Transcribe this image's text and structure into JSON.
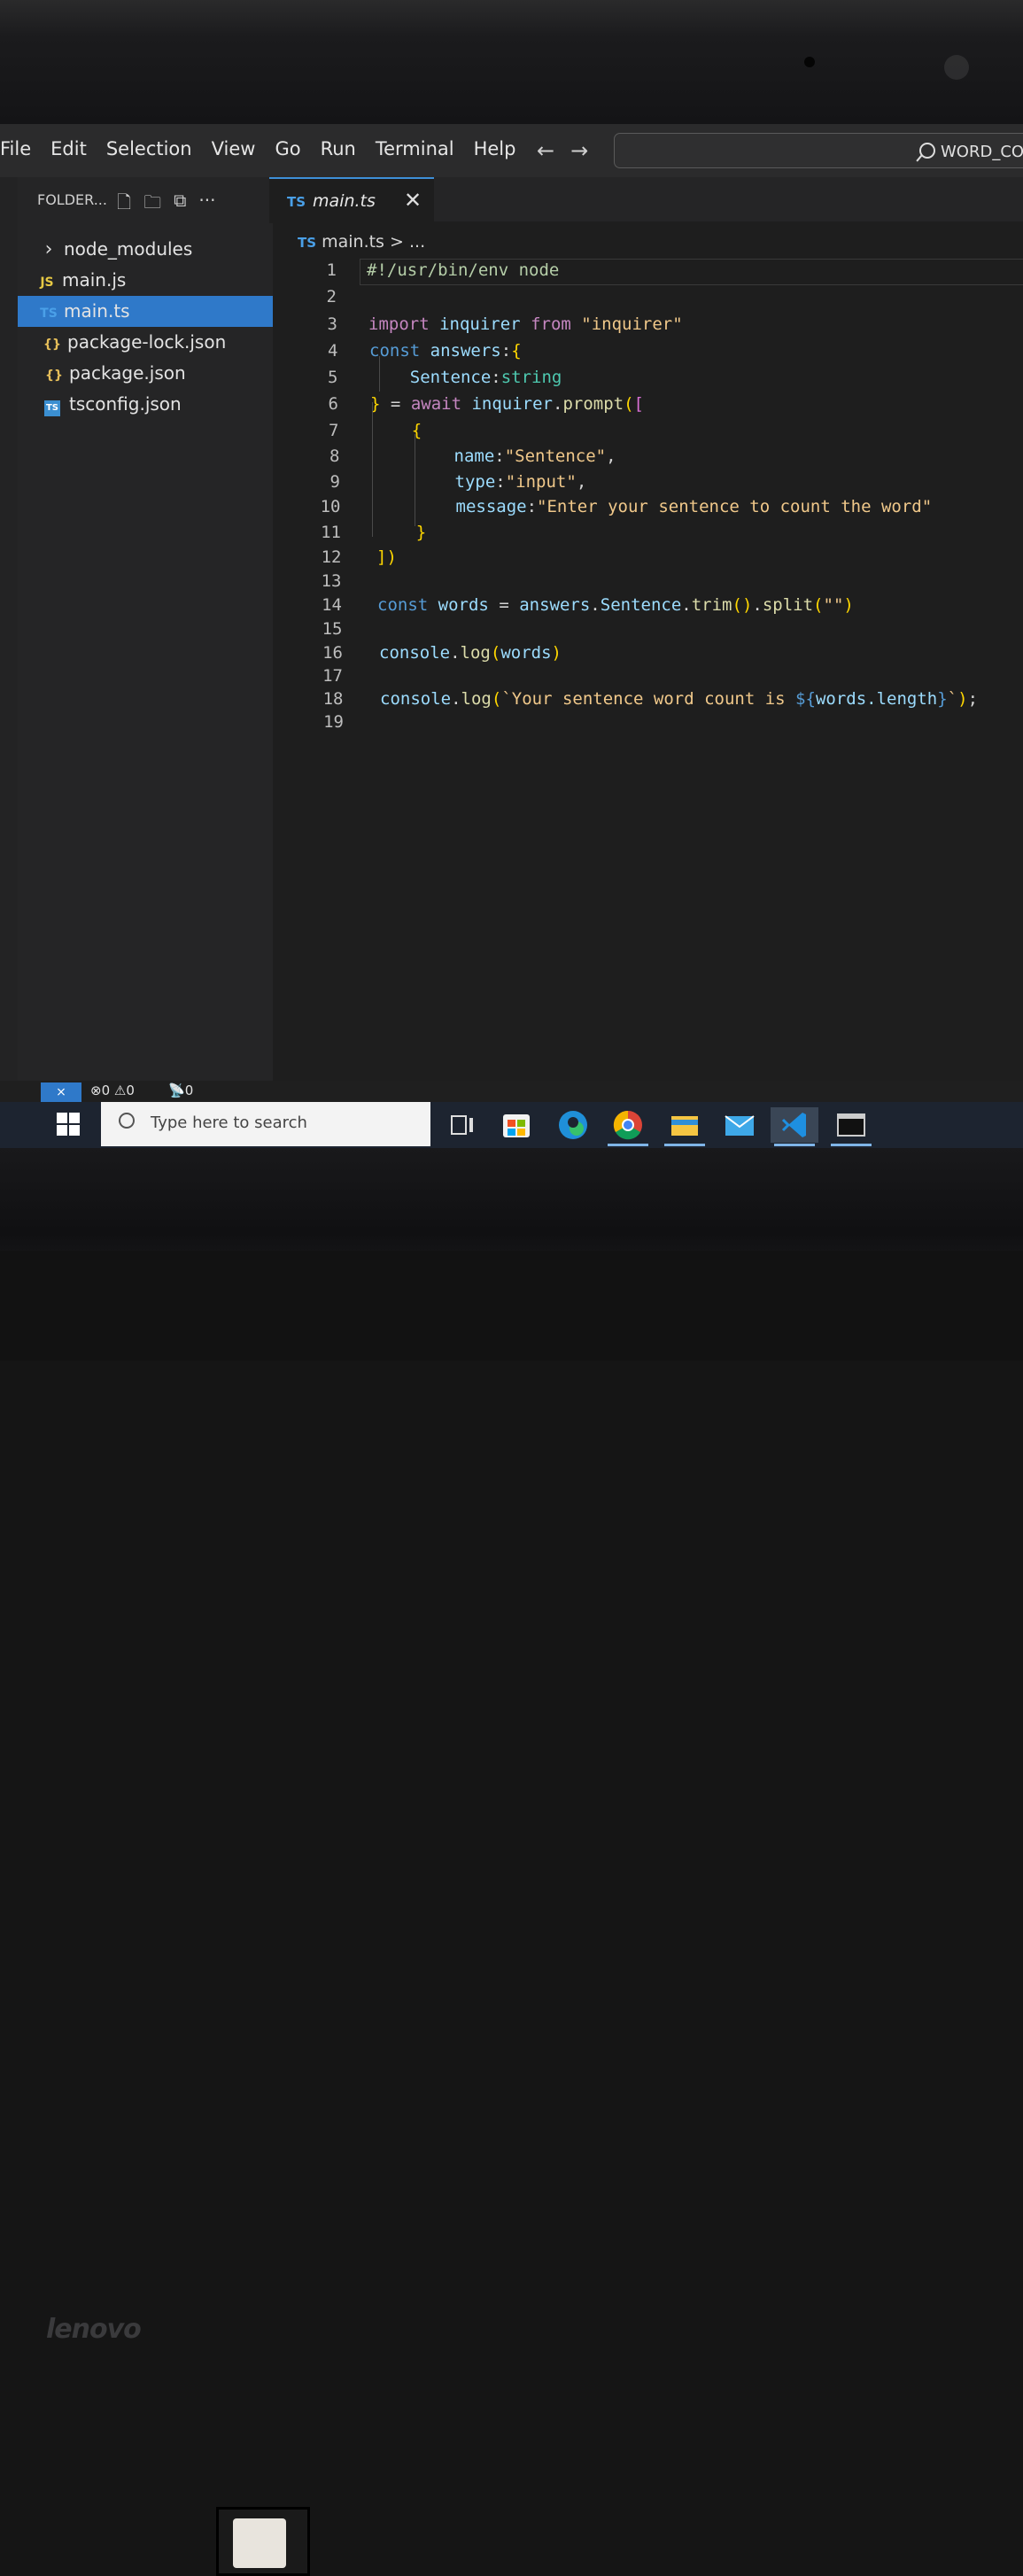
{
  "menu": [
    "File",
    "Edit",
    "Selection",
    "View",
    "Go",
    "Run",
    "Terminal",
    "Help"
  ],
  "nav": {
    "back": "←",
    "forward": "→"
  },
  "search_box": {
    "text": "WORD_CO"
  },
  "explorer": {
    "header": "FOLDER...",
    "tools": [
      "new-file",
      "new-folder",
      "collapse",
      "more"
    ],
    "more_label": "···",
    "items": [
      {
        "label": "node_modules",
        "icon": "›",
        "type": "folder"
      },
      {
        "label": "main.js",
        "icon": "JS",
        "type": "js"
      },
      {
        "label": "main.ts",
        "icon": "TS",
        "type": "ts",
        "active": true
      },
      {
        "label": "package-lock.json",
        "icon": "{}",
        "type": "json"
      },
      {
        "label": "package.json",
        "icon": "{}",
        "type": "json"
      },
      {
        "label": "tsconfig.json",
        "icon": "TS",
        "type": "tsc"
      }
    ]
  },
  "tab": {
    "icon": "TS",
    "label": "main.ts",
    "close": "✕"
  },
  "breadcrumb": {
    "icon": "TS",
    "file": "main.ts",
    "sep": ">",
    "rest": "..."
  },
  "code_lines": [
    "#!/usr/bin/env node",
    "",
    "import inquirer from \"inquirer\"",
    "const answers:{",
    "    Sentence:string",
    "} = await inquirer.prompt([",
    "    {",
    "        name:\"Sentence\",",
    "        type:\"input\",",
    "        message:\"Enter your sentence to count the word\"",
    "    }",
    "])",
    "",
    "const words = answers.Sentence.trim().split(\"\")",
    "",
    "console.log(words)",
    "",
    "console.log(`Your sentence word count is ${words.length}`);",
    ""
  ],
  "status": {
    "errors": "0",
    "warnings": "0",
    "ports": "0",
    "remote_icon": "⨯"
  },
  "taskbar": {
    "search_placeholder": "Type here to search"
  },
  "brand": "lenovo",
  "colors": {
    "accent": "#2f79c9",
    "tab_border": "#3d8fd8",
    "taskbar": "#1d2430"
  }
}
